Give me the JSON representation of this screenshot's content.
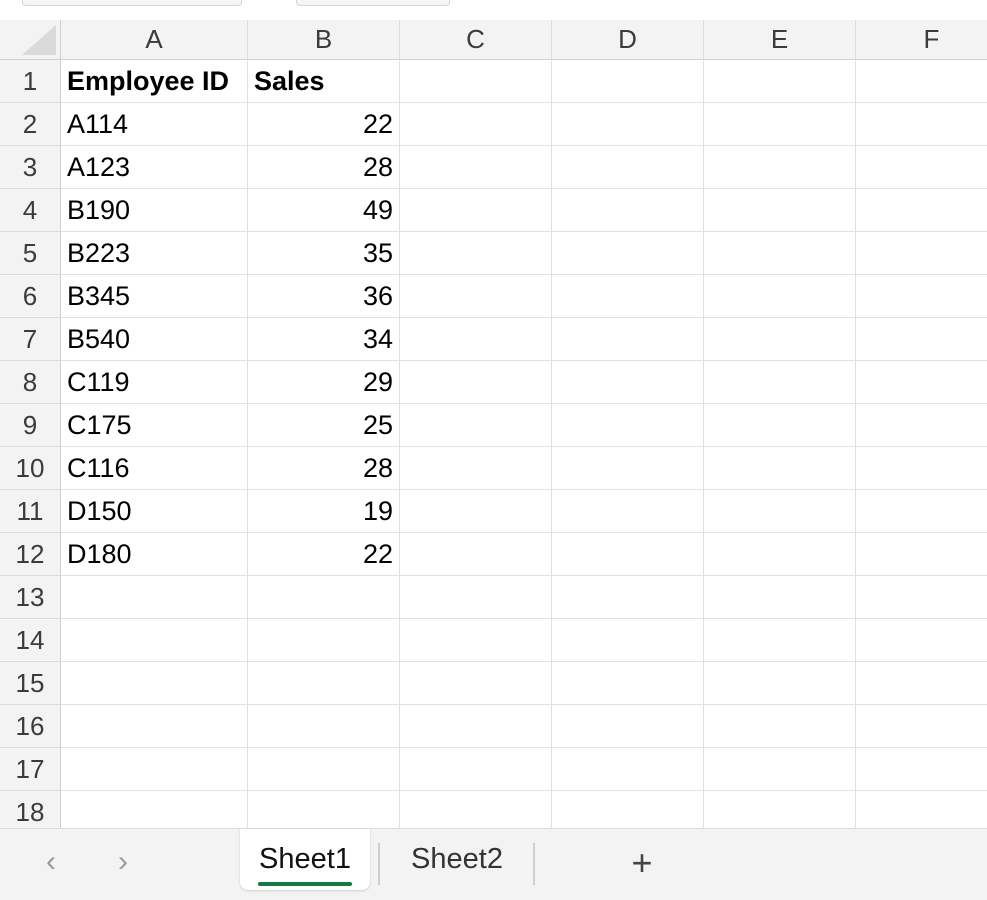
{
  "columns": [
    "A",
    "B",
    "C",
    "D",
    "E",
    "F"
  ],
  "rows": [
    {
      "num": "1",
      "a": "Employee ID",
      "b": "Sales"
    },
    {
      "num": "2",
      "a": "A114",
      "b": "22"
    },
    {
      "num": "3",
      "a": "A123",
      "b": "28"
    },
    {
      "num": "4",
      "a": "B190",
      "b": "49"
    },
    {
      "num": "5",
      "a": "B223",
      "b": "35"
    },
    {
      "num": "6",
      "a": "B345",
      "b": "36"
    },
    {
      "num": "7",
      "a": "B540",
      "b": "34"
    },
    {
      "num": "8",
      "a": "C119",
      "b": "29"
    },
    {
      "num": "9",
      "a": "C175",
      "b": "25"
    },
    {
      "num": "10",
      "a": "C116",
      "b": "28"
    },
    {
      "num": "11",
      "a": "D150",
      "b": "19"
    },
    {
      "num": "12",
      "a": "D180",
      "b": "22"
    },
    {
      "num": "13",
      "a": "",
      "b": ""
    },
    {
      "num": "14",
      "a": "",
      "b": ""
    },
    {
      "num": "15",
      "a": "",
      "b": ""
    },
    {
      "num": "16",
      "a": "",
      "b": ""
    },
    {
      "num": "17",
      "a": "",
      "b": ""
    },
    {
      "num": "18",
      "a": "",
      "b": ""
    }
  ],
  "sheet_tabs": [
    {
      "label": "Sheet1",
      "active": true
    },
    {
      "label": "Sheet2",
      "active": false
    }
  ],
  "nav": {
    "prev_icon": "chevron-left-icon",
    "next_icon": "chevron-right-icon",
    "prev_glyph": "‹",
    "next_glyph": "›"
  },
  "add_sheet": {
    "icon": "plus-icon",
    "glyph": "+"
  },
  "colors": {
    "accent": "#107c41",
    "header_bg": "#f3f3f3",
    "gridline": "#e1e1e1"
  }
}
